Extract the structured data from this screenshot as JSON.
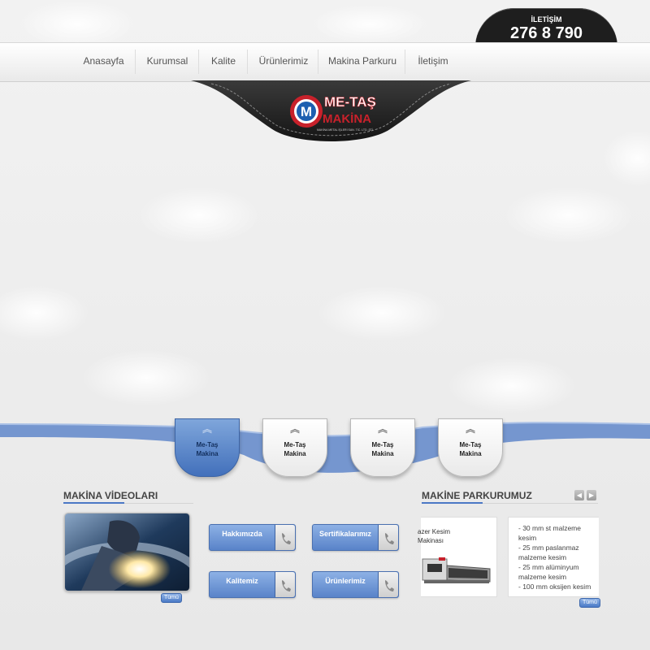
{
  "contact": {
    "label": "İLETİŞİM",
    "phone": "276 8 790"
  },
  "nav": {
    "items": [
      {
        "label": "Anasayfa"
      },
      {
        "label": "Kurumsal"
      },
      {
        "label": "Kalite"
      },
      {
        "label": "Ürünlerimiz"
      },
      {
        "label": "Makina Parkuru"
      },
      {
        "label": "İletişim"
      }
    ]
  },
  "logo": {
    "name_line1": "ME-TAŞ",
    "name_line2": "MAKİNA",
    "subtitle": "MAKİNA METAL İŞLERİ SAN. TİC. LTD. ŞTİ",
    "letter": "M"
  },
  "slider": {
    "pins": [
      {
        "label_line1": "Me-Taş",
        "label_line2": "Makina",
        "active": true
      },
      {
        "label_line1": "Me-Taş",
        "label_line2": "Makina",
        "active": false
      },
      {
        "label_line1": "Me-Taş",
        "label_line2": "Makina",
        "active": false
      },
      {
        "label_line1": "Me-Taş",
        "label_line2": "Makina",
        "active": false
      }
    ],
    "arrow_icon": "chevron-double-up-icon"
  },
  "videos": {
    "title": "MAKİNA VİDEOLARI",
    "all_label": "Tümü"
  },
  "quick_links": [
    {
      "label": "Hakkımızda"
    },
    {
      "label": "Sertifikalarımız"
    },
    {
      "label": "Kalitemiz"
    },
    {
      "label": "Ürünlerimiz"
    }
  ],
  "machines": {
    "title": "MAKİNE PARKURUMUZ",
    "all_label": "Tümü",
    "prev_icon": "arrow-left-icon",
    "next_icon": "arrow-right-icon",
    "machine_name_line1": "azer Kesim",
    "machine_name_line2": "Makinası",
    "specs": [
      "- 30 mm st malzeme",
      "kesim",
      "- 25 mm paslanmaz",
      "malzeme kesim",
      "- 25 mm alüminyum",
      "malzeme kesim",
      "- 100 mm oksijen kesim"
    ]
  },
  "colors": {
    "accent": "#4b78c5",
    "dark": "#1e1e1e",
    "logo_red": "#c8212b",
    "logo_blue": "#1d5fb0"
  }
}
